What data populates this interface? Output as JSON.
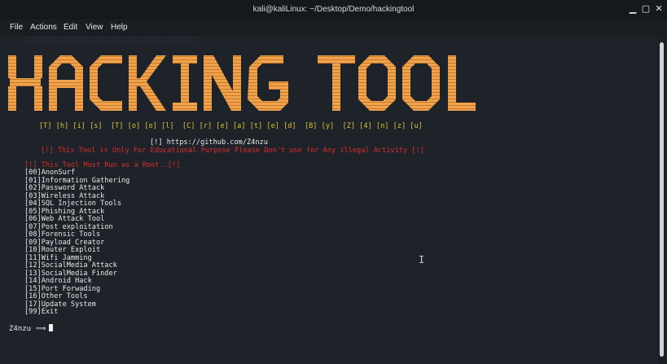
{
  "window": {
    "title": "kali@kaliLinux: ~/Desktop/Demo/hackingtool",
    "controls": [
      "▁",
      "▢",
      "✕"
    ]
  },
  "menu": [
    "File",
    "Actions",
    "Edit",
    "View",
    "Help"
  ],
  "banner": {
    "text": "HACKING TOOL",
    "color": "#f2a24a",
    "letter_row": "[T] [h] [i] [s]  [T] [o] [o] [l]  [C] [r] [e] [a] [t] [e] [d]  [B] [y]  [Z] [4] [n] [z] [u]"
  },
  "info": {
    "github": "[!] https://github.com/Z4nzu",
    "disclaimer": "[!] This Tool is Only For Educational Purpose Please Don't use for Any illegal Activity [!]",
    "root_warning": "[!] This Tool Must Run as a Root..[!]"
  },
  "options": [
    "[00]AnonSurf",
    "[01]Information Gathering",
    "[02]Password Attack",
    "[03]Wireless Attack",
    "[04]SQL Injection Tools",
    "[05]Phishing Attack",
    "[06]Web Attack Tool",
    "[07]Post exploitation",
    "[08]Forensic Tools",
    "[09]Payload Creator",
    "[10]Router Exploit",
    "[11]Wifi Jamming",
    "[12]SocialMedia Attack",
    "[13]SocialMedia Finder",
    "[14]Android Hack",
    "[15]Port Forwading",
    "[16]Other Tools",
    "[17]Update System",
    "[99]Exit"
  ],
  "prompt": {
    "user": "Z4nzu",
    "arrow": "⟹"
  },
  "colors": {
    "background": "#1e232a",
    "banner": "#f2a24a",
    "warning": "#e02a2a",
    "letters": "#d7c23c",
    "text": "#e8e8e8"
  }
}
